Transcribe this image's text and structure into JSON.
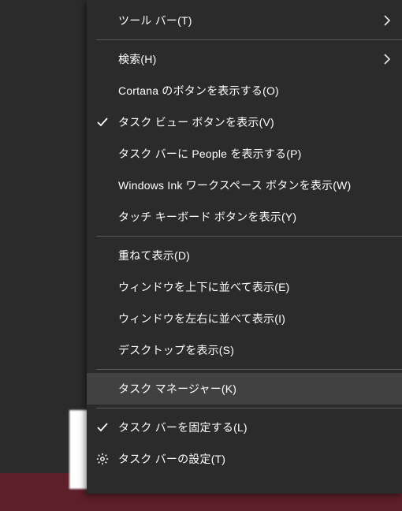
{
  "menu": {
    "toolbars": {
      "label": "ツール バー(T)"
    },
    "search": {
      "label": "検索(H)"
    },
    "cortana": {
      "label": "Cortana のボタンを表示する(O)"
    },
    "taskview": {
      "label": "タスク ビュー ボタンを表示(V)"
    },
    "people": {
      "label": "タスク バーに People を表示する(P)"
    },
    "ink": {
      "label": "Windows Ink ワークスペース ボタンを表示(W)"
    },
    "touchkb": {
      "label": "タッチ キーボード ボタンを表示(Y)"
    },
    "cascade": {
      "label": "重ねて表示(D)"
    },
    "stack": {
      "label": "ウィンドウを上下に並べて表示(E)"
    },
    "sidebyside": {
      "label": "ウィンドウを左右に並べて表示(I)"
    },
    "showdesktop": {
      "label": "デスクトップを表示(S)"
    },
    "taskmgr": {
      "label": "タスク マネージャー(K)"
    },
    "lock": {
      "label": "タスク バーを固定する(L)"
    },
    "settings": {
      "label": "タスク バーの設定(T)"
    }
  }
}
